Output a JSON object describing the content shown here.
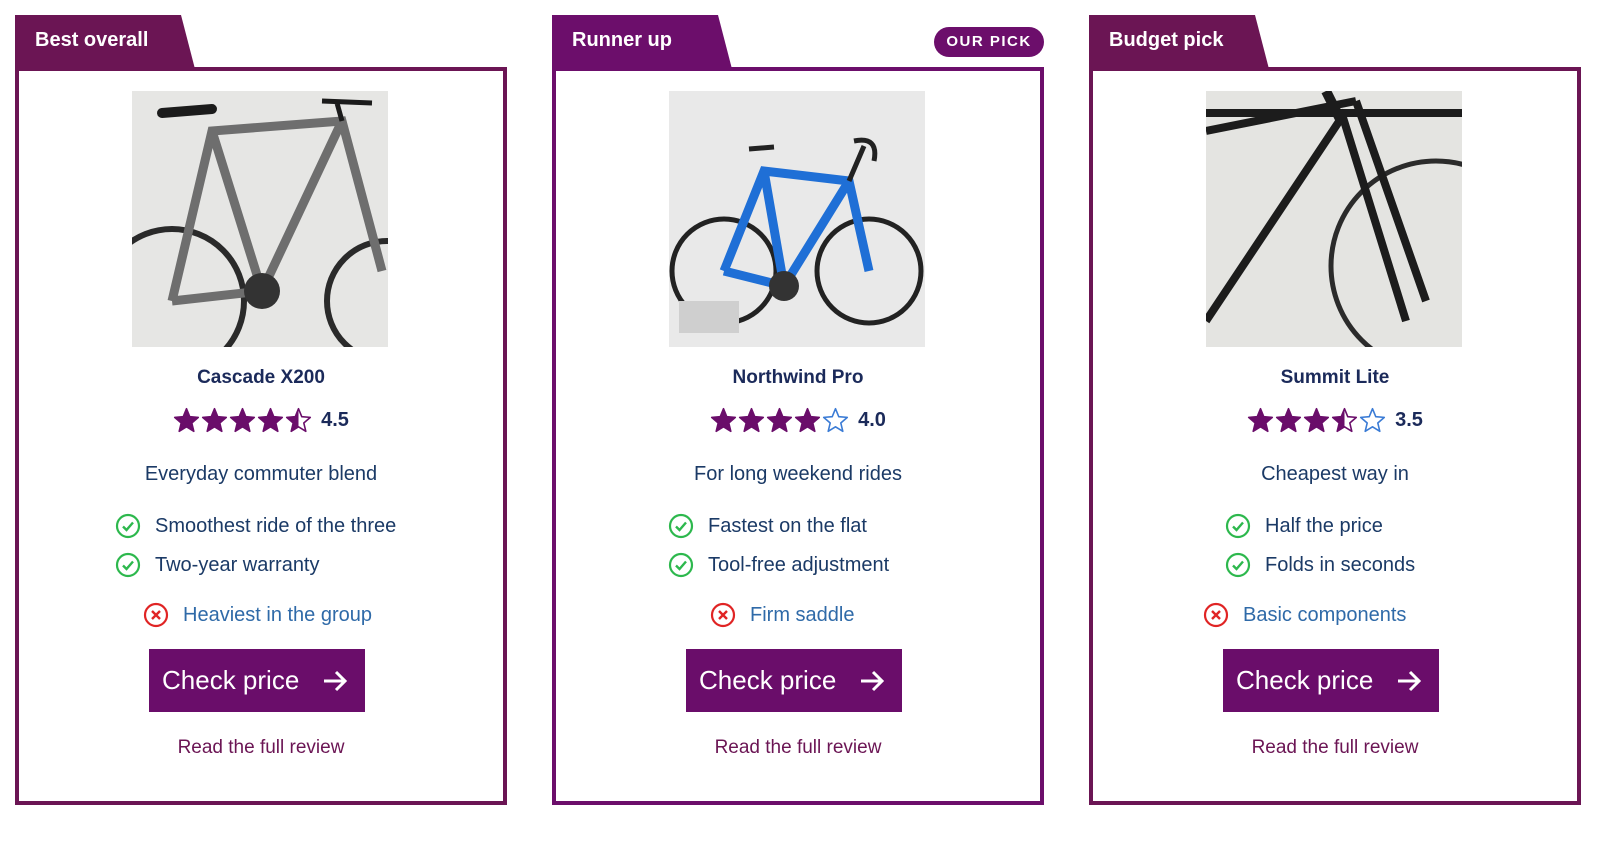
{
  "colors": {
    "card1_accent": "#6b1554",
    "card2_accent": "#6c0e6b",
    "card3_accent": "#6b1554",
    "button": "#6a0d6a",
    "star_fill": "#6a0d6a",
    "check_green": "#2db84d",
    "cross_red": "#e02424"
  },
  "cards": [
    {
      "label": "Best overall",
      "image": "bicycle-photo",
      "name": "Cascade X200",
      "rating": 4.5,
      "rating_text": "4.5",
      "tagline": "Everyday commuter blend",
      "pros": [
        "Smoothest ride of the three",
        "Two-year warranty"
      ],
      "con": "Heaviest in the group",
      "button": "Check price",
      "review": "Read the full review"
    },
    {
      "label": "Runner up",
      "badge": "OUR PICK",
      "image": "bicycle-photo",
      "name": "Northwind Pro",
      "rating": 4.0,
      "rating_text": "4.0",
      "tagline": "For long weekend rides",
      "pros": [
        "Fastest on the flat",
        "Tool-free adjustment"
      ],
      "con": "Firm saddle",
      "button": "Check price",
      "review": "Read the full review"
    },
    {
      "label": "Budget pick",
      "image": "bicycle-photo",
      "name": "Summit Lite",
      "rating": 3.5,
      "rating_text": "3.5",
      "tagline": "Cheapest way in",
      "pros": [
        "Half the price",
        "Folds in seconds"
      ],
      "con": "Basic components",
      "button": "Check price",
      "review": "Read the full review"
    }
  ],
  "icons": {
    "star": "star-icon",
    "check": "check-circle-icon",
    "cross": "x-circle-icon",
    "arrow": "arrow-right-icon"
  }
}
